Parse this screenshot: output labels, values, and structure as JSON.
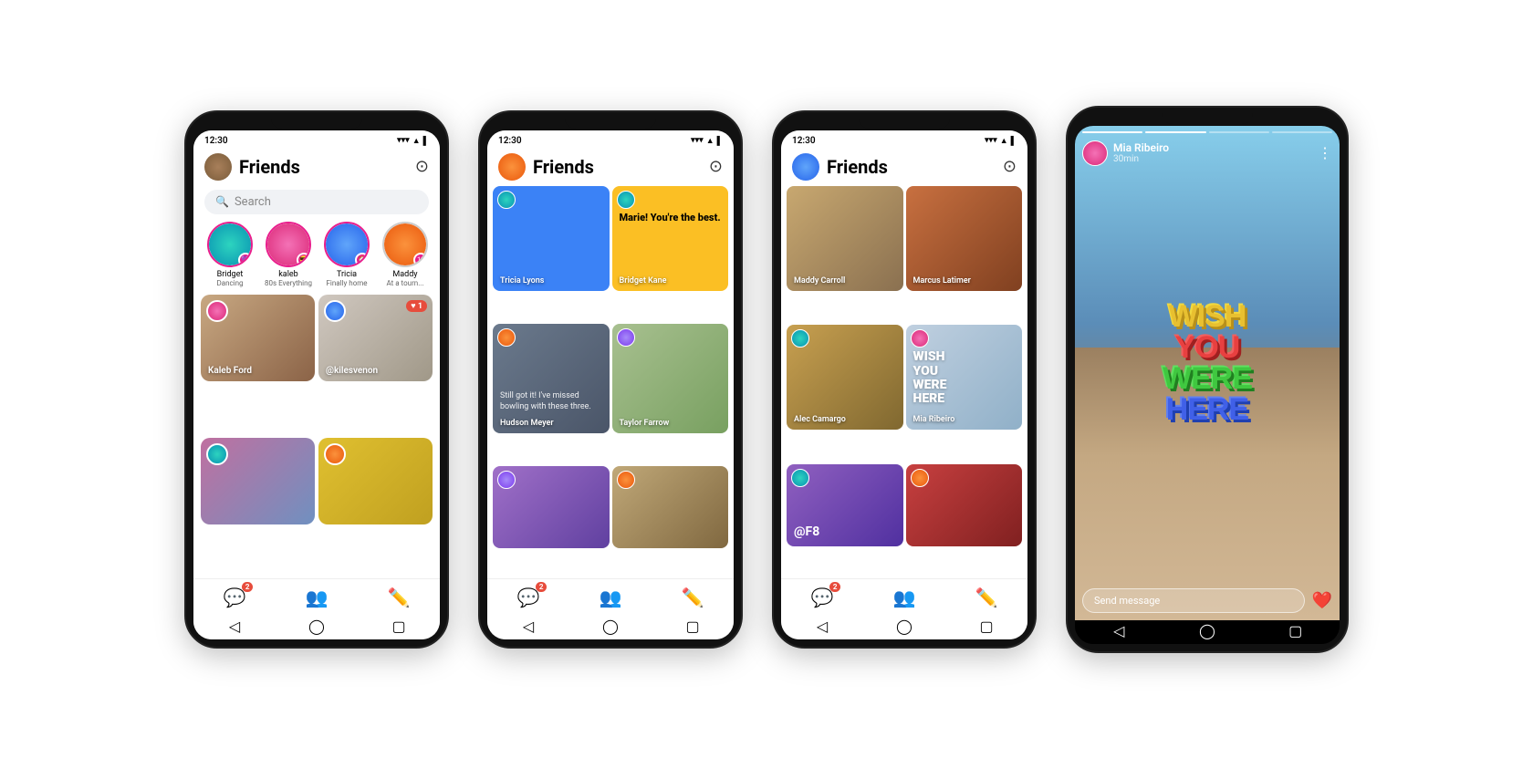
{
  "phones": [
    {
      "id": "phone1",
      "type": "friends-list",
      "status_time": "12:30",
      "header": {
        "title": "Friends",
        "camera_icon": "📷"
      },
      "search": {
        "placeholder": "Search"
      },
      "stories": [
        {
          "name": "Bridget",
          "sub": "Dancing",
          "color": "teal"
        },
        {
          "name": "kaleb",
          "sub": "80s Everything",
          "color": "pink"
        },
        {
          "name": "Tricia",
          "sub": "Finally home",
          "color": "blue"
        },
        {
          "name": "Maddy",
          "sub": "At a tourn...",
          "color": "orange",
          "badge": "10"
        }
      ],
      "cards": [
        {
          "label": "Kaleb Ford",
          "bg": "photo-friends",
          "type": "photo"
        },
        {
          "label": "@kilesvenon",
          "bg": "photo-dog",
          "type": "photo",
          "notif": "♥ 1"
        },
        {
          "label": "",
          "bg": "photo-pink-blue",
          "type": "photo"
        },
        {
          "label": "",
          "bg": "photo-yellow-emoji",
          "type": "photo"
        }
      ],
      "nav": {
        "messages_badge": "2"
      }
    },
    {
      "id": "phone2",
      "type": "friends-grid",
      "status_time": "12:30",
      "header": {
        "title": "Friends",
        "camera_icon": "📷"
      },
      "cards": [
        {
          "label": "Tricia Lyons",
          "bg": "card-bg-blue",
          "text": "",
          "tall": true
        },
        {
          "label": "Bridget Kane",
          "bg": "card-bg-yellow",
          "text": "Marie! You're the best.",
          "tall": true,
          "text_color": "#000"
        },
        {
          "label": "Hudson Meyer",
          "bg": "photo-bowling",
          "text": "Still got it! I've missed bowling with these three.",
          "tall": true
        },
        {
          "label": "Taylor Farrow",
          "bg": "photo-golf",
          "text": "",
          "tall": true
        },
        {
          "label": "",
          "bg": "photo-purple",
          "text": "",
          "short": true
        },
        {
          "label": "",
          "bg": "photo-woman2",
          "text": "",
          "short": true
        }
      ],
      "nav": {
        "messages_badge": "2"
      }
    },
    {
      "id": "phone3",
      "type": "friends-grid2",
      "status_time": "12:30",
      "header": {
        "title": "Friends",
        "camera_icon": "📷"
      },
      "cards": [
        {
          "label": "Maddy Carroll",
          "bg": "photo-woman",
          "tall": true
        },
        {
          "label": "Marcus Latimer",
          "bg": "photo-canyon",
          "tall": true
        },
        {
          "label": "Alec Camargo",
          "bg": "photo-woman2",
          "tall": true
        },
        {
          "label": "Mia Ribeiro",
          "bg": "wish-card",
          "tall": true
        },
        {
          "label": "@F8",
          "bg": "photo-purple2",
          "short": true
        },
        {
          "label": "",
          "bg": "photo-lantern",
          "short": true
        }
      ],
      "nav": {
        "messages_badge": "2"
      }
    },
    {
      "id": "phone4",
      "type": "story-view",
      "user": {
        "name": "Mia Ribeiro",
        "time": "30min"
      },
      "wish_text": "WISH\nYOU\nWERE\nHERE",
      "send_placeholder": "Send message",
      "nav": {}
    }
  ]
}
